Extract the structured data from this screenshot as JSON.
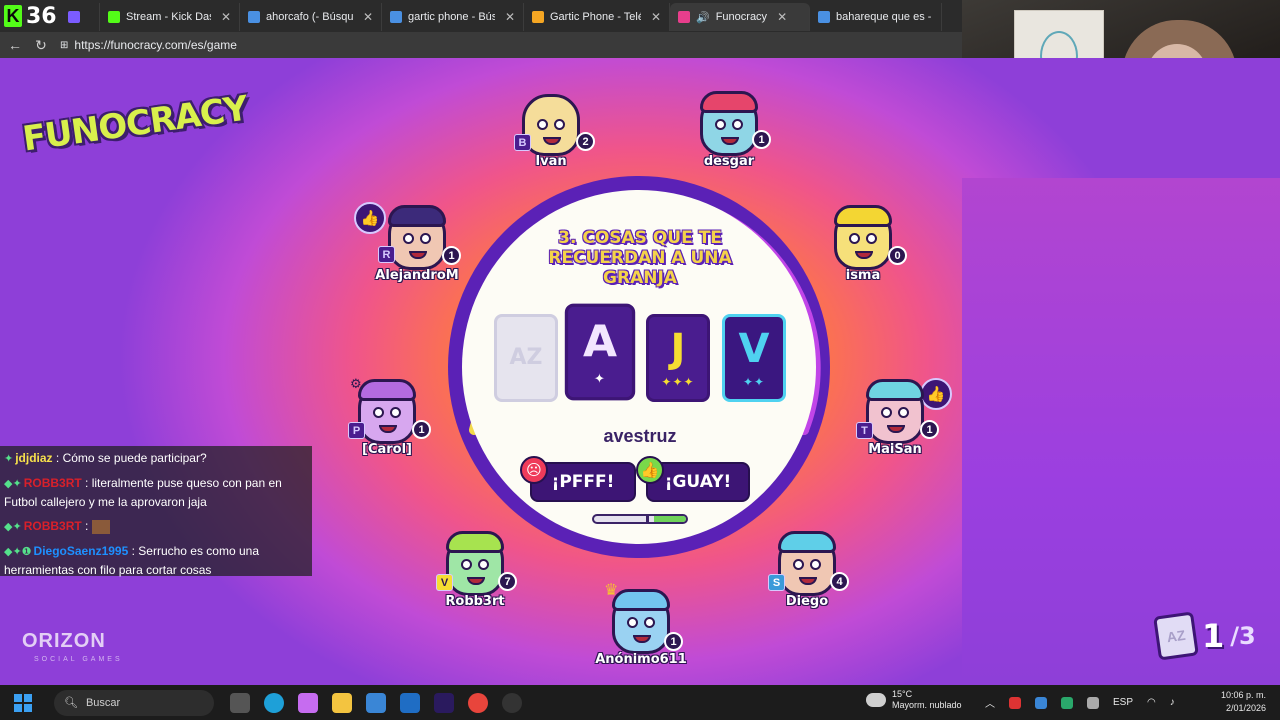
{
  "browser": {
    "kick_counter": "36",
    "tabs": [
      {
        "title": "",
        "favicon": "#7b5cff",
        "active": false
      },
      {
        "title": "Stream - Kick Dashboard",
        "favicon": "#53fc18",
        "active": false
      },
      {
        "title": "ahorcafo (- Búsqueda",
        "favicon": "#4a90e2",
        "active": false
      },
      {
        "title": "gartic phone - Búsqueda",
        "favicon": "#4a90e2",
        "active": false
      },
      {
        "title": "Gartic Phone - Teléfono D",
        "favicon": "#f5a623",
        "active": false
      },
      {
        "title": "Funocracy",
        "favicon": "#e83e8c",
        "active": true
      },
      {
        "title": "bahareque que es - Búsq",
        "favicon": "#4a90e2",
        "active": false
      }
    ],
    "url": "https://funocracy.com/es/game"
  },
  "game": {
    "logo_text": "FUNOCRACY",
    "prompt": "3. COSAS QUE TE RECUERDAN A UNA GRANJA",
    "cards": [
      {
        "letter": "A",
        "stars": "✦",
        "style": "a"
      },
      {
        "letter": "J",
        "stars": "✦✦✦",
        "style": "j"
      },
      {
        "letter": "V",
        "stars": "✦✦",
        "style": "v"
      }
    ],
    "ghost_card": "AZ",
    "answer": "avestruz",
    "pfff_label": "¡PFFF!",
    "guay_label": "¡GUAY!",
    "vote_progress_green": 0.35,
    "round_current": "1",
    "round_total": "/3",
    "round_icon": "AZ",
    "brand": "ORIZON",
    "brand_sub": "SOCIAL GAMES",
    "players": [
      {
        "name": "Ivan",
        "score": "2",
        "letter": "B"
      },
      {
        "name": "desgar",
        "score": "1",
        "letter": ""
      },
      {
        "name": "AlejandroM",
        "score": "1",
        "letter": "R"
      },
      {
        "name": "isma",
        "score": "0",
        "letter": ""
      },
      {
        "name": "[Carol]",
        "score": "1",
        "letter": "P"
      },
      {
        "name": "MaiSan",
        "score": "1",
        "letter": "T"
      },
      {
        "name": "Robb3rt",
        "score": "7",
        "letter": "V"
      },
      {
        "name": "Diego",
        "score": "4",
        "letter": "S"
      },
      {
        "name": "Anónimo611",
        "score": "1",
        "letter": ""
      }
    ]
  },
  "chat": [
    {
      "badges": "✦",
      "user": "jdjdiaz",
      "text": " : Cómo se puede participar?",
      "color": "a"
    },
    {
      "badges": "◆✦",
      "user": "ROBB3RT",
      "text": " : literalmente puse queso con pan en Futbol callejero y me la aprovaron jaja",
      "color": "b"
    },
    {
      "badges": "◆✦",
      "user": "ROBB3RT",
      "text": " : ",
      "color": "b"
    },
    {
      "badges": "◆✦❶",
      "user": "DiegoSaenz1995",
      "text": " : Serrucho es como una herramientas con filo para cortar cosas",
      "color": "c"
    }
  ],
  "taskbar": {
    "search_placeholder": "Buscar",
    "weather_temp": "15°C",
    "weather_desc": "Mayorm. nublado",
    "lang": "ESP",
    "time": "10:06 p. m.",
    "date": "2/01/2026"
  }
}
